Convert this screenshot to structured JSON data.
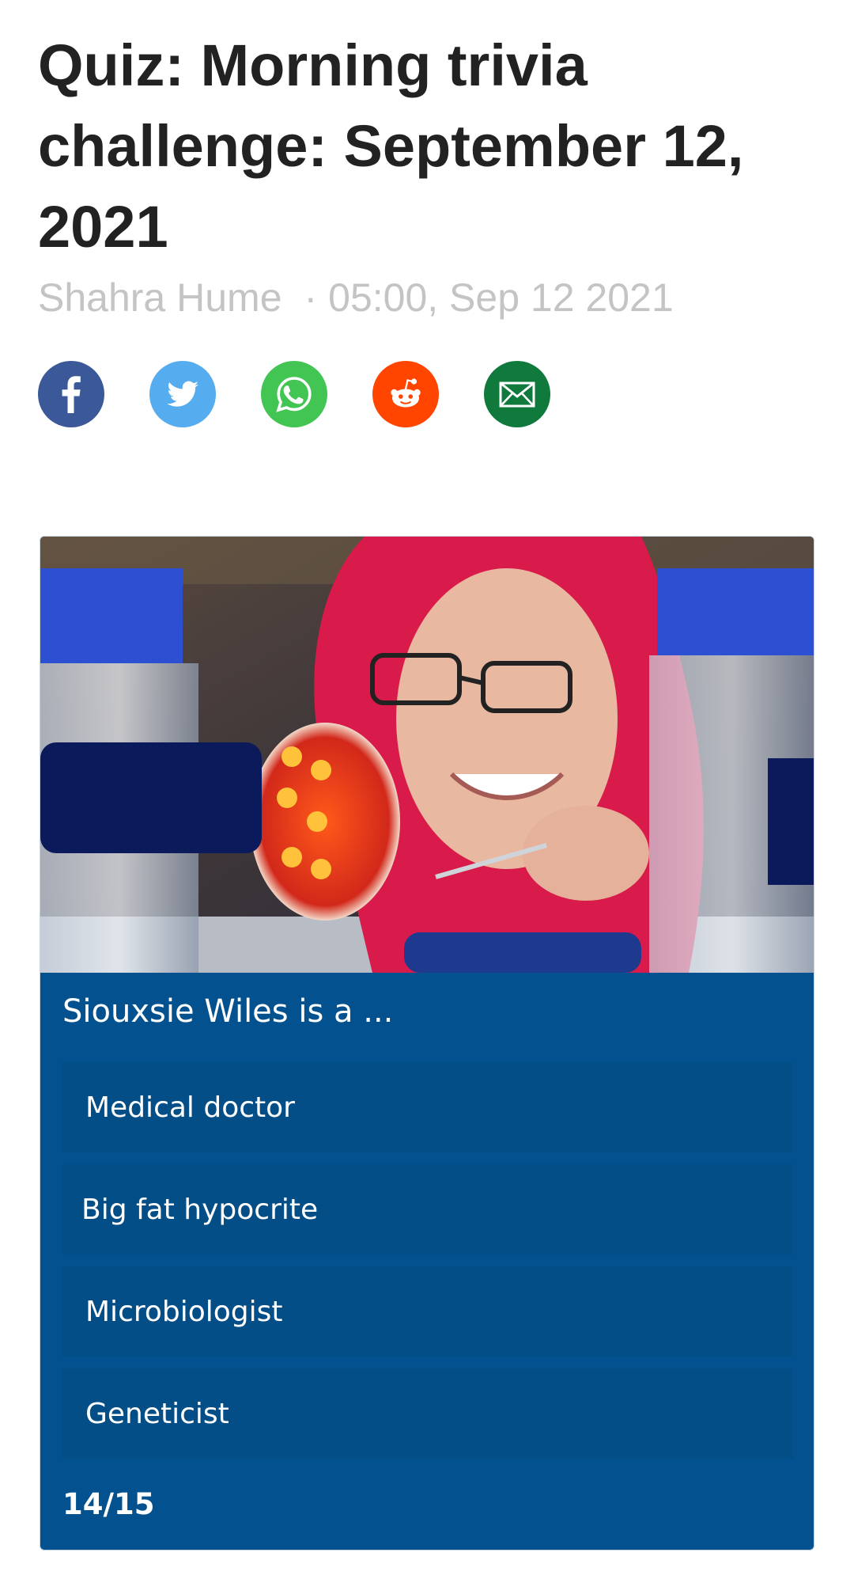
{
  "article": {
    "title": "Quiz: Morning trivia challenge: September 12, 2021",
    "author": "Shahra Hume",
    "separator": "·",
    "timestamp": "05:00, Sep 12 2021"
  },
  "share": [
    {
      "name": "facebook",
      "icon": "facebook-icon",
      "color": "#3b5998"
    },
    {
      "name": "twitter",
      "icon": "twitter-icon",
      "color": "#55acee"
    },
    {
      "name": "whatsapp",
      "icon": "whatsapp-icon",
      "color": "#43c553"
    },
    {
      "name": "reddit",
      "icon": "reddit-icon",
      "color": "#ff4500"
    },
    {
      "name": "email",
      "icon": "email-icon",
      "color": "#0f7a3c"
    }
  ],
  "quiz": {
    "question": "Siouxsie Wiles is a ...",
    "answers": [
      {
        "label": "Medical doctor"
      },
      {
        "label": "Big fat hypocrite"
      },
      {
        "label": "Microbiologist"
      },
      {
        "label": "Geneticist"
      }
    ],
    "progress": "14/15",
    "card_color": "#03528f",
    "answer_color": "#034e86"
  }
}
